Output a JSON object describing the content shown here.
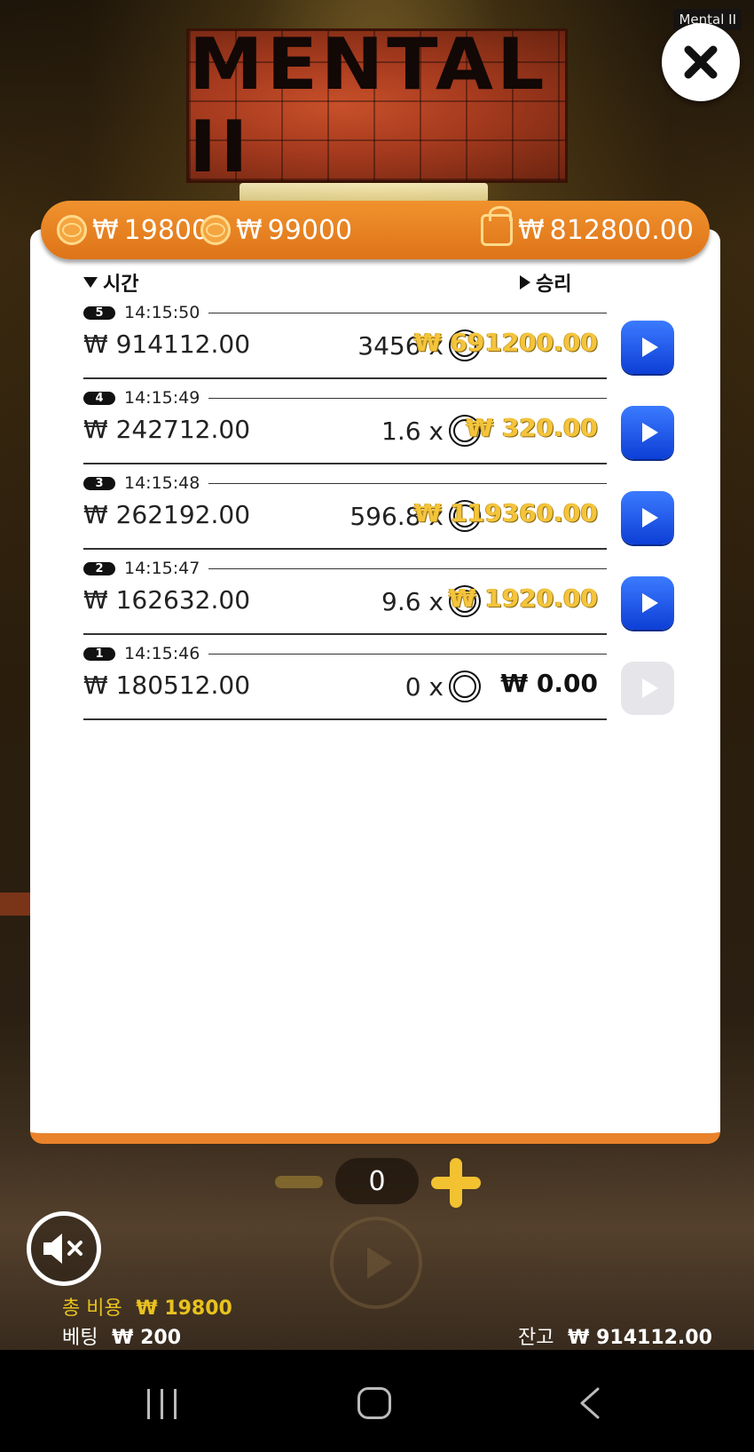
{
  "game_title_tag": "Mental II",
  "logo_text": "MENTAL II",
  "header": {
    "currency_symbol": "₩",
    "cost_1": "19800",
    "cost_2": "99000",
    "wallet_value": "812800.00"
  },
  "columns": {
    "time_label": "시간",
    "win_label": "승리"
  },
  "rows": [
    {
      "round": "5",
      "time": "14:15:50",
      "balance": "₩ 914112.00",
      "multiplier": "3456 x",
      "win": "₩ 691200.00",
      "playable": true
    },
    {
      "round": "4",
      "time": "14:15:49",
      "balance": "₩ 242712.00",
      "multiplier": "1.6 x",
      "win": "₩ 320.00",
      "playable": true
    },
    {
      "round": "3",
      "time": "14:15:48",
      "balance": "₩ 262192.00",
      "multiplier": "596.8 x",
      "win": "₩ 119360.00",
      "playable": true
    },
    {
      "round": "2",
      "time": "14:15:47",
      "balance": "₩ 162632.00",
      "multiplier": "9.6 x",
      "win": "₩ 1920.00",
      "playable": true
    },
    {
      "round": "1",
      "time": "14:15:46",
      "balance": "₩ 180512.00",
      "multiplier": "0 x",
      "win": "₩ 0.00",
      "playable": false
    }
  ],
  "controls": {
    "count": "0"
  },
  "footer": {
    "total_cost_label": "총 비용",
    "total_cost_value": "₩ 19800",
    "bet_label": "베팅",
    "bet_value": "₩ 200",
    "balance_label": "잔고",
    "balance_value": "₩ 914112.00"
  },
  "colors": {
    "accent_orange": "#e9832b",
    "play_blue": "#1a4ff0",
    "win_gold": "#f4c43c"
  }
}
